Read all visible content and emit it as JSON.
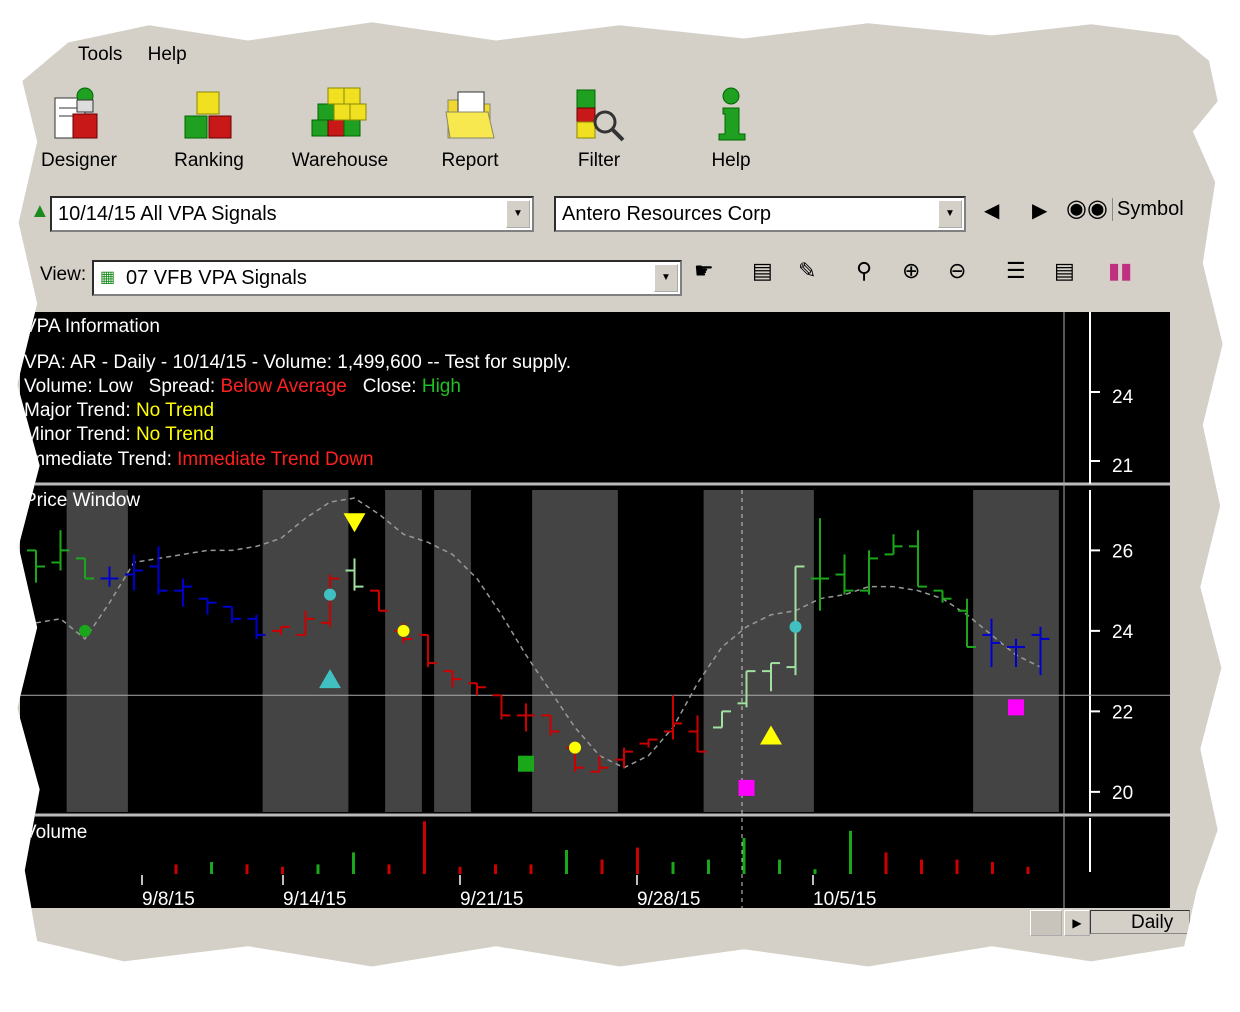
{
  "menu": {
    "tools": "Tools",
    "help": "Help"
  },
  "toolbar": [
    {
      "label": "Designer",
      "icon": "designer-icon"
    },
    {
      "label": "Ranking",
      "icon": "ranking-icon"
    },
    {
      "label": "Warehouse",
      "icon": "warehouse-icon"
    },
    {
      "label": "Report",
      "icon": "report-icon"
    },
    {
      "label": "Filter",
      "icon": "filter-icon"
    },
    {
      "label": "Help",
      "icon": "help-icon"
    }
  ],
  "signal_list": {
    "value": "10/14/15 All VPA Signals"
  },
  "symbol_select": {
    "value": "Antero Resources Corp"
  },
  "symbol_label": "Symbol",
  "view": {
    "label": "View:",
    "value": "07 VFB VPA Signals"
  },
  "vpa_info": {
    "header": "VPA Information",
    "line1": "VPA: AR - Daily - 10/14/15 - Volume: 1,499,600 -- Test for supply.",
    "volume_label": "Volume:",
    "volume_value": "Low",
    "spread_label": "Spread:",
    "spread_value": "Below Average",
    "close_label": "Close:",
    "close_value": "High",
    "major_label": "Major Trend:",
    "major_value": "No Trend",
    "minor_label": "Minor Trend:",
    "minor_value": "No Trend",
    "immediate_label": "Immediate Trend:",
    "immediate_value": "Immediate Trend Down"
  },
  "price_window_label": "Price Window",
  "volume_label": "Volume",
  "timeframe": "Daily",
  "colors": {
    "up": "#1aa81a",
    "down": "#cc0000",
    "neutral": "#0000cc",
    "pale": "#a0e0a0",
    "highlight": "#444444",
    "gold": "#ffff00",
    "cyan": "#40c0c0",
    "magenta": "#ff00ff"
  },
  "chart_data": {
    "type": "bar",
    "x_ticks": [
      "9/8/15",
      "9/14/15",
      "9/21/15",
      "9/28/15",
      "10/5/15"
    ],
    "info_axis_ticks": [
      "24",
      "21"
    ],
    "price_axis_ticks": [
      "26",
      "24",
      "22",
      "20"
    ],
    "price_ylim": [
      19.5,
      27.5
    ],
    "bars": [
      {
        "o": 26.0,
        "h": 26.0,
        "l": 25.2,
        "c": 25.6,
        "dir": "up"
      },
      {
        "o": 25.7,
        "h": 26.5,
        "l": 25.5,
        "c": 26.0,
        "dir": "up"
      },
      {
        "o": 25.8,
        "h": 25.8,
        "l": 25.3,
        "c": 25.3,
        "dir": "up"
      },
      {
        "o": 25.3,
        "h": 25.6,
        "l": 25.1,
        "c": 25.3,
        "dir": "neutral"
      },
      {
        "o": 25.4,
        "h": 25.9,
        "l": 25.0,
        "c": 25.5,
        "dir": "neutral"
      },
      {
        "o": 25.6,
        "h": 26.1,
        "l": 24.9,
        "c": 25.0,
        "dir": "neutral"
      },
      {
        "o": 25.0,
        "h": 25.3,
        "l": 24.6,
        "c": 25.1,
        "dir": "neutral"
      },
      {
        "o": 24.8,
        "h": 24.8,
        "l": 24.4,
        "c": 24.7,
        "dir": "neutral"
      },
      {
        "o": 24.6,
        "h": 24.6,
        "l": 24.2,
        "c": 24.3,
        "dir": "neutral"
      },
      {
        "o": 24.3,
        "h": 24.4,
        "l": 23.8,
        "c": 23.9,
        "dir": "neutral"
      },
      {
        "o": 24.0,
        "h": 24.1,
        "l": 23.9,
        "c": 24.1,
        "dir": "down"
      },
      {
        "o": 23.9,
        "h": 24.5,
        "l": 23.9,
        "c": 24.3,
        "dir": "down"
      },
      {
        "o": 24.2,
        "h": 25.4,
        "l": 24.1,
        "c": 25.3,
        "dir": "down"
      },
      {
        "o": 25.5,
        "h": 25.8,
        "l": 25.0,
        "c": 25.1,
        "dir": "pale"
      },
      {
        "o": 25.0,
        "h": 25.0,
        "l": 24.5,
        "c": 24.5,
        "dir": "down"
      },
      {
        "o": 24.0,
        "h": 24.2,
        "l": 23.7,
        "c": 23.8,
        "dir": "down"
      },
      {
        "o": 23.9,
        "h": 23.9,
        "l": 23.1,
        "c": 23.2,
        "dir": "down"
      },
      {
        "o": 23.0,
        "h": 23.0,
        "l": 22.6,
        "c": 22.8,
        "dir": "down"
      },
      {
        "o": 22.7,
        "h": 22.7,
        "l": 22.4,
        "c": 22.6,
        "dir": "down"
      },
      {
        "o": 22.4,
        "h": 22.4,
        "l": 21.8,
        "c": 21.9,
        "dir": "down"
      },
      {
        "o": 21.9,
        "h": 22.2,
        "l": 21.5,
        "c": 21.9,
        "dir": "down"
      },
      {
        "o": 21.9,
        "h": 21.9,
        "l": 21.4,
        "c": 21.5,
        "dir": "down"
      },
      {
        "o": 21.1,
        "h": 21.1,
        "l": 20.5,
        "c": 20.6,
        "dir": "down"
      },
      {
        "o": 20.5,
        "h": 20.9,
        "l": 20.5,
        "c": 20.6,
        "dir": "down"
      },
      {
        "o": 20.8,
        "h": 21.1,
        "l": 20.6,
        "c": 21.0,
        "dir": "down"
      },
      {
        "o": 21.2,
        "h": 21.3,
        "l": 21.1,
        "c": 21.3,
        "dir": "down"
      },
      {
        "o": 21.5,
        "h": 22.4,
        "l": 21.3,
        "c": 21.7,
        "dir": "down"
      },
      {
        "o": 21.5,
        "h": 21.9,
        "l": 21.0,
        "c": 21.0,
        "dir": "down"
      },
      {
        "o": 21.6,
        "h": 22.0,
        "l": 21.6,
        "c": 22.0,
        "dir": "pale"
      },
      {
        "o": 22.2,
        "h": 23.0,
        "l": 22.1,
        "c": 23.0,
        "dir": "pale"
      },
      {
        "o": 23.0,
        "h": 23.2,
        "l": 22.5,
        "c": 23.2,
        "dir": "pale"
      },
      {
        "o": 23.1,
        "h": 25.6,
        "l": 22.9,
        "c": 25.6,
        "dir": "pale"
      },
      {
        "o": 25.3,
        "h": 26.8,
        "l": 24.5,
        "c": 25.3,
        "dir": "up"
      },
      {
        "o": 25.4,
        "h": 25.9,
        "l": 24.9,
        "c": 25.0,
        "dir": "up"
      },
      {
        "o": 25.0,
        "h": 26.0,
        "l": 24.9,
        "c": 25.8,
        "dir": "up"
      },
      {
        "o": 25.9,
        "h": 26.4,
        "l": 25.9,
        "c": 26.1,
        "dir": "up"
      },
      {
        "o": 26.1,
        "h": 26.5,
        "l": 25.1,
        "c": 25.1,
        "dir": "up"
      },
      {
        "o": 25.0,
        "h": 25.0,
        "l": 24.7,
        "c": 24.8,
        "dir": "up"
      },
      {
        "o": 24.5,
        "h": 24.8,
        "l": 23.6,
        "c": 23.6,
        "dir": "up"
      },
      {
        "o": 23.9,
        "h": 24.3,
        "l": 23.1,
        "c": 23.7,
        "dir": "neutral"
      },
      {
        "o": 23.6,
        "h": 23.8,
        "l": 23.1,
        "c": 23.6,
        "dir": "neutral"
      },
      {
        "o": 23.9,
        "h": 24.1,
        "l": 22.9,
        "c": 23.8,
        "dir": "neutral"
      }
    ],
    "moving_average": [
      24.2,
      24.3,
      23.8,
      24.7,
      25.7,
      25.8,
      25.9,
      26.0,
      26.0,
      26.1,
      26.3,
      26.8,
      27.2,
      27.3,
      26.9,
      26.4,
      26.2,
      25.9,
      25.3,
      24.4,
      23.4,
      22.5,
      21.6,
      20.9,
      20.6,
      20.9,
      21.6,
      22.7,
      23.6,
      24.1,
      24.4,
      24.5,
      24.8,
      24.9,
      25.1,
      25.1,
      25.0,
      24.8,
      24.4,
      23.9,
      23.4,
      23.1
    ],
    "highlight_ranges": [
      [
        2,
        3
      ],
      [
        10,
        12
      ],
      [
        15,
        15
      ],
      [
        17,
        17
      ],
      [
        21,
        21
      ],
      [
        22,
        23
      ],
      [
        28,
        31
      ],
      [
        39,
        41
      ]
    ],
    "markers": [
      {
        "i": 2,
        "y": 24.0,
        "shape": "circle",
        "color": "up"
      },
      {
        "i": 12,
        "y": 24.9,
        "shape": "circle",
        "color": "cyan"
      },
      {
        "i": 12,
        "y": 22.8,
        "shape": "triangle-up",
        "color": "cyan"
      },
      {
        "i": 13,
        "y": 26.7,
        "shape": "triangle-down",
        "color": "gold"
      },
      {
        "i": 15,
        "y": 24.0,
        "shape": "circle",
        "color": "gold"
      },
      {
        "i": 20,
        "y": 20.7,
        "shape": "square",
        "color": "up"
      },
      {
        "i": 22,
        "y": 21.1,
        "shape": "circle",
        "color": "gold"
      },
      {
        "i": 29,
        "y": 20.1,
        "shape": "square",
        "color": "magenta"
      },
      {
        "i": 31,
        "y": 24.1,
        "shape": "circle",
        "color": "cyan"
      },
      {
        "i": 30,
        "y": 21.4,
        "shape": "triangle-up",
        "color": "gold"
      },
      {
        "i": 40,
        "y": 22.1,
        "shape": "square",
        "color": "magenta"
      }
    ],
    "volume": [
      {
        "v": 4,
        "dir": "down"
      },
      {
        "v": 5,
        "dir": "up"
      },
      {
        "v": 4,
        "dir": "down"
      },
      {
        "v": 3,
        "dir": "down"
      },
      {
        "v": 4,
        "dir": "up"
      },
      {
        "v": 9,
        "dir": "up"
      },
      {
        "v": 4,
        "dir": "down"
      },
      {
        "v": 22,
        "dir": "down"
      },
      {
        "v": 3,
        "dir": "down"
      },
      {
        "v": 4,
        "dir": "down"
      },
      {
        "v": 4,
        "dir": "down"
      },
      {
        "v": 10,
        "dir": "up"
      },
      {
        "v": 6,
        "dir": "down"
      },
      {
        "v": 11,
        "dir": "down"
      },
      {
        "v": 5,
        "dir": "up"
      },
      {
        "v": 6,
        "dir": "up"
      },
      {
        "v": 15,
        "dir": "up"
      },
      {
        "v": 6,
        "dir": "up"
      },
      {
        "v": 2,
        "dir": "up"
      },
      {
        "v": 18,
        "dir": "up"
      },
      {
        "v": 9,
        "dir": "down"
      },
      {
        "v": 6,
        "dir": "down"
      },
      {
        "v": 6,
        "dir": "down"
      },
      {
        "v": 5,
        "dir": "down"
      },
      {
        "v": 3,
        "dir": "down"
      }
    ]
  }
}
